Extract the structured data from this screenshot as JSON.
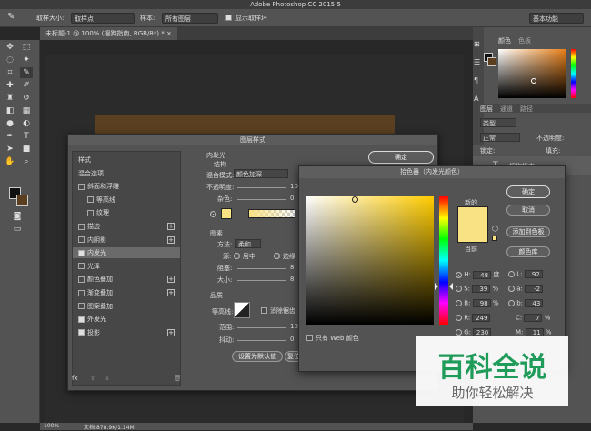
{
  "app": {
    "title": "Adobe Photoshop CC 2015.5"
  },
  "optbar": {
    "sample_size_label": "取样大小:",
    "sample_size": "取样点",
    "sample_label": "样本:",
    "sample": "所有图层",
    "show_ring_label": "显示取样环",
    "workspace": "基本功能"
  },
  "doc": {
    "tab": "未标题-1 @ 100% (搜狗指南, RGB/8*) *"
  },
  "status": {
    "zoom": "100%",
    "docsize": "文档:878.9K/1.14M"
  },
  "panels": {
    "color_tab": "颜色",
    "swatches_tab": "色板",
    "layers_tab": "图层",
    "channels_tab": "通道",
    "paths_tab": "路径",
    "kind": "类型",
    "blend": "正常",
    "opacity_label": "不透明度:",
    "lock_label": "锁定:",
    "fill_label": "填充:",
    "layer_name": "搜狗指南"
  },
  "layer_style": {
    "title": "图层样式",
    "items": [
      {
        "label": "样式",
        "check": false,
        "plus": false
      },
      {
        "label": "混合选项",
        "check": false,
        "plus": false
      },
      {
        "label": "斜面和浮雕",
        "check": true,
        "on": false,
        "plus": false
      },
      {
        "label": "等高线",
        "check": true,
        "on": false,
        "plus": false,
        "indent": true
      },
      {
        "label": "纹理",
        "check": true,
        "on": false,
        "plus": false,
        "indent": true
      },
      {
        "label": "描边",
        "check": true,
        "on": false,
        "plus": true
      },
      {
        "label": "内阴影",
        "check": true,
        "on": false,
        "plus": true
      },
      {
        "label": "内发光",
        "check": true,
        "on": true,
        "plus": false,
        "selected": true
      },
      {
        "label": "光泽",
        "check": true,
        "on": false,
        "plus": false
      },
      {
        "label": "颜色叠加",
        "check": true,
        "on": false,
        "plus": true
      },
      {
        "label": "渐变叠加",
        "check": true,
        "on": false,
        "plus": true
      },
      {
        "label": "图案叠加",
        "check": true,
        "on": false,
        "plus": false
      },
      {
        "label": "外发光",
        "check": true,
        "on": true,
        "plus": false
      },
      {
        "label": "投影",
        "check": true,
        "on": true,
        "plus": true
      }
    ],
    "section_title": "内发光",
    "structure": "结构",
    "blend_mode_label": "混合模式:",
    "blend_mode": "颜色加深",
    "opacity_label": "不透明度:",
    "opacity_value": "100",
    "noise_label": "杂色:",
    "noise_value": "0",
    "elements": "图素",
    "method_label": "方法:",
    "method": "柔和",
    "source_label": "源:",
    "center": "居中",
    "edge": "边缘",
    "choke_label": "阻塞:",
    "choke_value": "8",
    "size_label": "大小:",
    "size_value": "8",
    "quality": "品质",
    "contour_label": "等高线:",
    "antialias": "消除锯齿",
    "range_label": "范围:",
    "range_value": "100",
    "jitter_label": "抖动:",
    "jitter_value": "0",
    "ok": "确定",
    "set_default": "设置为默认值",
    "reset_default": "复位为",
    "fx": "fx"
  },
  "picker": {
    "title": "拾色器（内发光颜色）",
    "new_label": "新的",
    "current_label": "当前",
    "new_color": "#F9E283",
    "current_color": "#F9E283",
    "ok": "确定",
    "cancel": "取消",
    "add_swatch": "添加到色板",
    "library": "颜色库",
    "web_only": "只有 Web 颜色",
    "h": {
      "label": "H:",
      "value": "48",
      "unit": "度"
    },
    "s": {
      "label": "S:",
      "value": "39",
      "unit": "%"
    },
    "b": {
      "label": "B:",
      "value": "98",
      "unit": "%"
    },
    "r": {
      "label": "R:",
      "value": "249"
    },
    "g": {
      "label": "G:",
      "value": "230"
    },
    "L": {
      "label": "L:",
      "value": "92"
    },
    "a": {
      "label": "a:",
      "value": "-2"
    },
    "bb": {
      "label": "b:",
      "value": "43"
    },
    "c": {
      "label": "C:",
      "value": "7",
      "unit": "%"
    },
    "m": {
      "label": "M:",
      "value": "11",
      "unit": "%"
    }
  },
  "watermark": {
    "title": "百科全说",
    "subtitle": "助你轻松解决"
  }
}
